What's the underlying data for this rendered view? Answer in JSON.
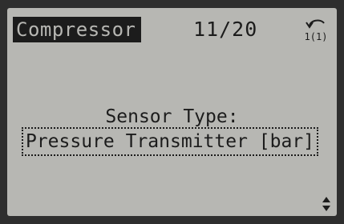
{
  "header": {
    "title": "Compressor",
    "page_indicator": "11/20",
    "nav_icon": "back-arrow-icon",
    "nav_icon_text": "1(1)"
  },
  "parameter": {
    "label": "Sensor Type:",
    "value": "Pressure Transmitter [bar]"
  },
  "footer": {
    "scroll_icon": "up-down-arrows-icon"
  },
  "colors": {
    "lcd_background": "#b7b7b3",
    "lcd_ink": "#1c1c1c",
    "bezel": "#2e2e2e"
  }
}
